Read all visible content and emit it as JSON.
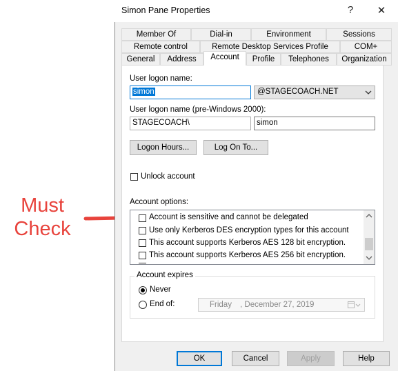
{
  "annotation": {
    "line1": "Must",
    "line2": "Check",
    "color": "#e8433c"
  },
  "window": {
    "title": "Simon Pane Properties",
    "help_glyph": "?",
    "close_glyph": "✕"
  },
  "tabs": {
    "row1": [
      "Member Of",
      "Dial-in",
      "Environment",
      "Sessions"
    ],
    "row2": [
      "Remote control",
      "Remote Desktop Services Profile",
      "COM+"
    ],
    "row3": [
      "General",
      "Address",
      "Account",
      "Profile",
      "Telephones",
      "Organization"
    ],
    "active": "Account"
  },
  "account": {
    "logon_label": "User logon name:",
    "logon_value": "simon",
    "domain_value": "@STAGECOACH.NET",
    "pre2000_label": "User logon name (pre-Windows 2000):",
    "pre2000_domain": "STAGECOACH\\",
    "pre2000_user": "simon",
    "logon_hours_button": "Logon Hours...",
    "logon_to_button": "Log On To...",
    "unlock_label": "Unlock account",
    "options_label": "Account options:",
    "options": [
      "Account is sensitive and cannot be delegated",
      "Use only Kerberos DES encryption types for this account",
      "This account supports Kerberos AES 128 bit encryption.",
      "This account supports Kerberos AES 256 bit encryption."
    ],
    "expires_label": "Account expires",
    "never_label": "Never",
    "endof_label": "End of:",
    "date_day": "Friday",
    "date_rest": ", December 27, 2019"
  },
  "footer": {
    "ok": "OK",
    "cancel": "Cancel",
    "apply": "Apply",
    "help": "Help"
  }
}
